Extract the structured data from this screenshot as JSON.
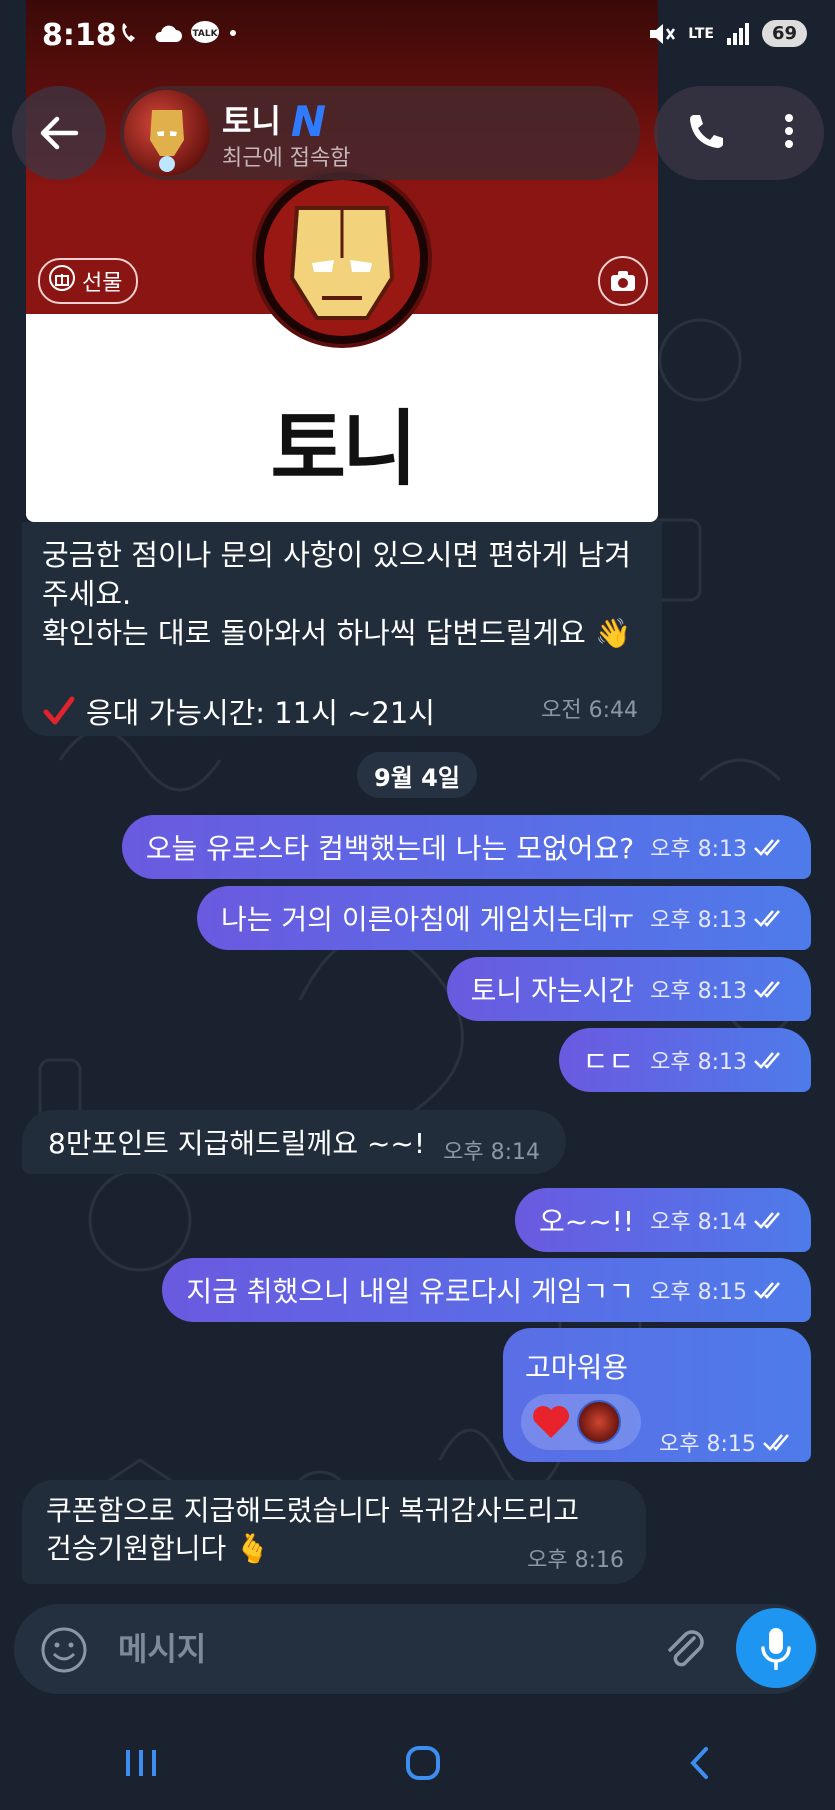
{
  "status_bar": {
    "time": "8:18",
    "battery": "69",
    "network": "LTE"
  },
  "header": {
    "name": "토니",
    "badge": "N",
    "subtitle": "최근에 접속함"
  },
  "profile_card": {
    "gift_label": "선물",
    "title": "토니"
  },
  "info_message": {
    "text": "궁금한 점이나 문의 사항이 있으시면 편하게 남겨주세요.\n확인하는 대로 돌아와서 하나씩 답변드릴게요 👋",
    "hours": "응대 가능시간:  11시 ~21시",
    "time": "오전 6:44"
  },
  "date_separator": "9월 4일",
  "messages": [
    {
      "text": "오늘 유로스타 컴백했는데 나는 모없어요?",
      "time": "오후 8:13"
    },
    {
      "text": "나는 거의 이른아침에 게임치는데ㅠ",
      "time": "오후 8:13"
    },
    {
      "text": "토니 자는시간",
      "time": "오후 8:13"
    },
    {
      "text": "ㄷㄷ",
      "time": "오후 8:13"
    },
    {
      "text": "8만포인트 지급해드릴께요 ~~!",
      "time": "오후 8:14"
    },
    {
      "text": "오~~!!",
      "time": "오후 8:14"
    },
    {
      "text": "지금 취했으니 내일 유로다시 게임ㄱㄱ",
      "time": "오후 8:15"
    },
    {
      "text": "고마워용",
      "time": "오후 8:15"
    },
    {
      "text": "쿠폰함으로 지급해드렸습니다 복귀감사드리고\n건승기원합니다 🫰",
      "time": "오후 8:16"
    }
  ],
  "composer": {
    "placeholder": "메시지"
  },
  "colors": {
    "outgoing": "#5a6ee6",
    "incoming": "#212d3b",
    "accent": "#1e95f0",
    "badge": "#2f7bff"
  }
}
